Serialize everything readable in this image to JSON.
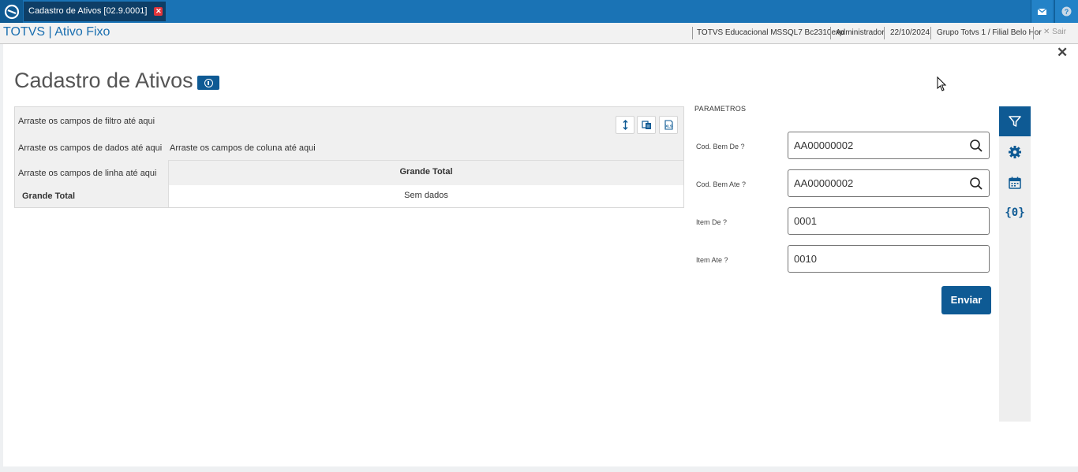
{
  "topbar": {
    "tab_title": "Cadastro de Ativos [02.9.0001]",
    "tab_close": "✕"
  },
  "statusbar": {
    "module": "TOTVS | Ativo Fixo",
    "environment": "TOTVS Educacional MSSQL7 Bc2310exp",
    "user": "Administrador",
    "date": "22/10/2024",
    "branch": "Grupo Totvs 1 / Filial Belo Hor",
    "exit": "✕  Sair"
  },
  "page": {
    "title": "Cadastro de Ativos",
    "close": "✕"
  },
  "pivot": {
    "filter_drop": "Arraste os campos de filtro até aqui",
    "data_drop": "Arraste os campos de dados até aqui",
    "column_drop": "Arraste os campos de coluna até aqui",
    "row_drop": "Arraste os campos de linha até aqui",
    "column_total": "Grande Total",
    "row_total": "Grande Total",
    "empty_cell": "Sem dados"
  },
  "params": {
    "title": "PARAMETROS",
    "fields": [
      {
        "label": "Cod. Bem De ?",
        "value": "AA00000002"
      },
      {
        "label": "Cod. Bem Ate ?",
        "value": "AA00000002"
      },
      {
        "label": "Item De ?",
        "value": "0001"
      },
      {
        "label": "Item Ate ?",
        "value": "0010"
      }
    ],
    "submit": "Enviar"
  },
  "sidebar": {
    "items": [
      "filter-icon",
      "gear-icon",
      "calendar-icon",
      "variables-icon"
    ],
    "variables_glyph": "{0}"
  },
  "colors": {
    "accent": "#0e5a94",
    "topbar": "#1a73b5"
  }
}
